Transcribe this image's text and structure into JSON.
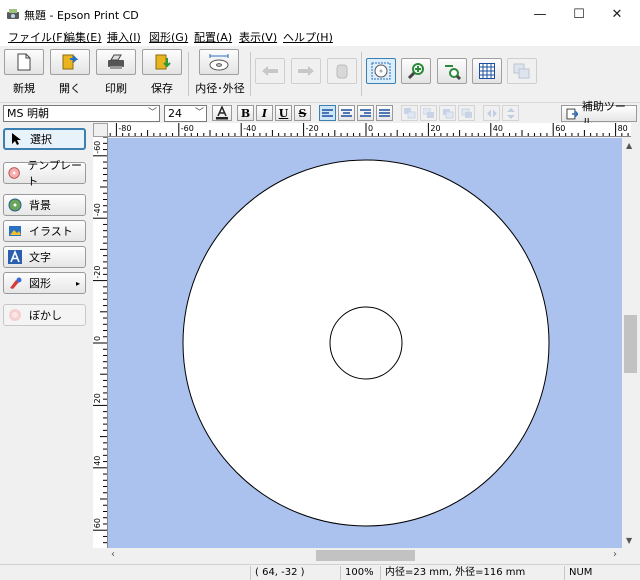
{
  "window": {
    "title": "無題 - Epson Print CD",
    "min": "—",
    "max": "☐",
    "close": "✕"
  },
  "menu": [
    "ファイル(F)",
    "編集(E)",
    "挿入(I)",
    "図形(G)",
    "配置(A)",
    "表示(V)",
    "ヘルプ(H)"
  ],
  "toolbar": {
    "new": "新規",
    "open": "開く",
    "print": "印刷",
    "save": "保存",
    "diameter": "内径･外径"
  },
  "format": {
    "font": "MS 明朝",
    "size": "24",
    "bold": "B",
    "italic": "I",
    "underline": "U",
    "strike": "S"
  },
  "assist": "補助ツール",
  "sidebar": {
    "select": "選択",
    "template": "テンプレート",
    "background": "背景",
    "illustration": "イラスト",
    "text": "文字",
    "shape": "図形",
    "shape_arrow": "▸",
    "blur": "ぼかし"
  },
  "ruler": {
    "h_labels": [
      "-80",
      "-60",
      "-40",
      "-20",
      "0",
      "20",
      "40",
      "60",
      "80"
    ],
    "v_labels": [
      "-60",
      "-40",
      "-20",
      "0",
      "20",
      "40",
      "60"
    ]
  },
  "status": {
    "coords": "(  64, -32 )",
    "zoom": "100%",
    "disc": "内径=23 mm, 外径=116 mm",
    "num": "NUM"
  },
  "colors": {
    "canvas": "#abc1ee",
    "accent": "#3c7fb1"
  }
}
